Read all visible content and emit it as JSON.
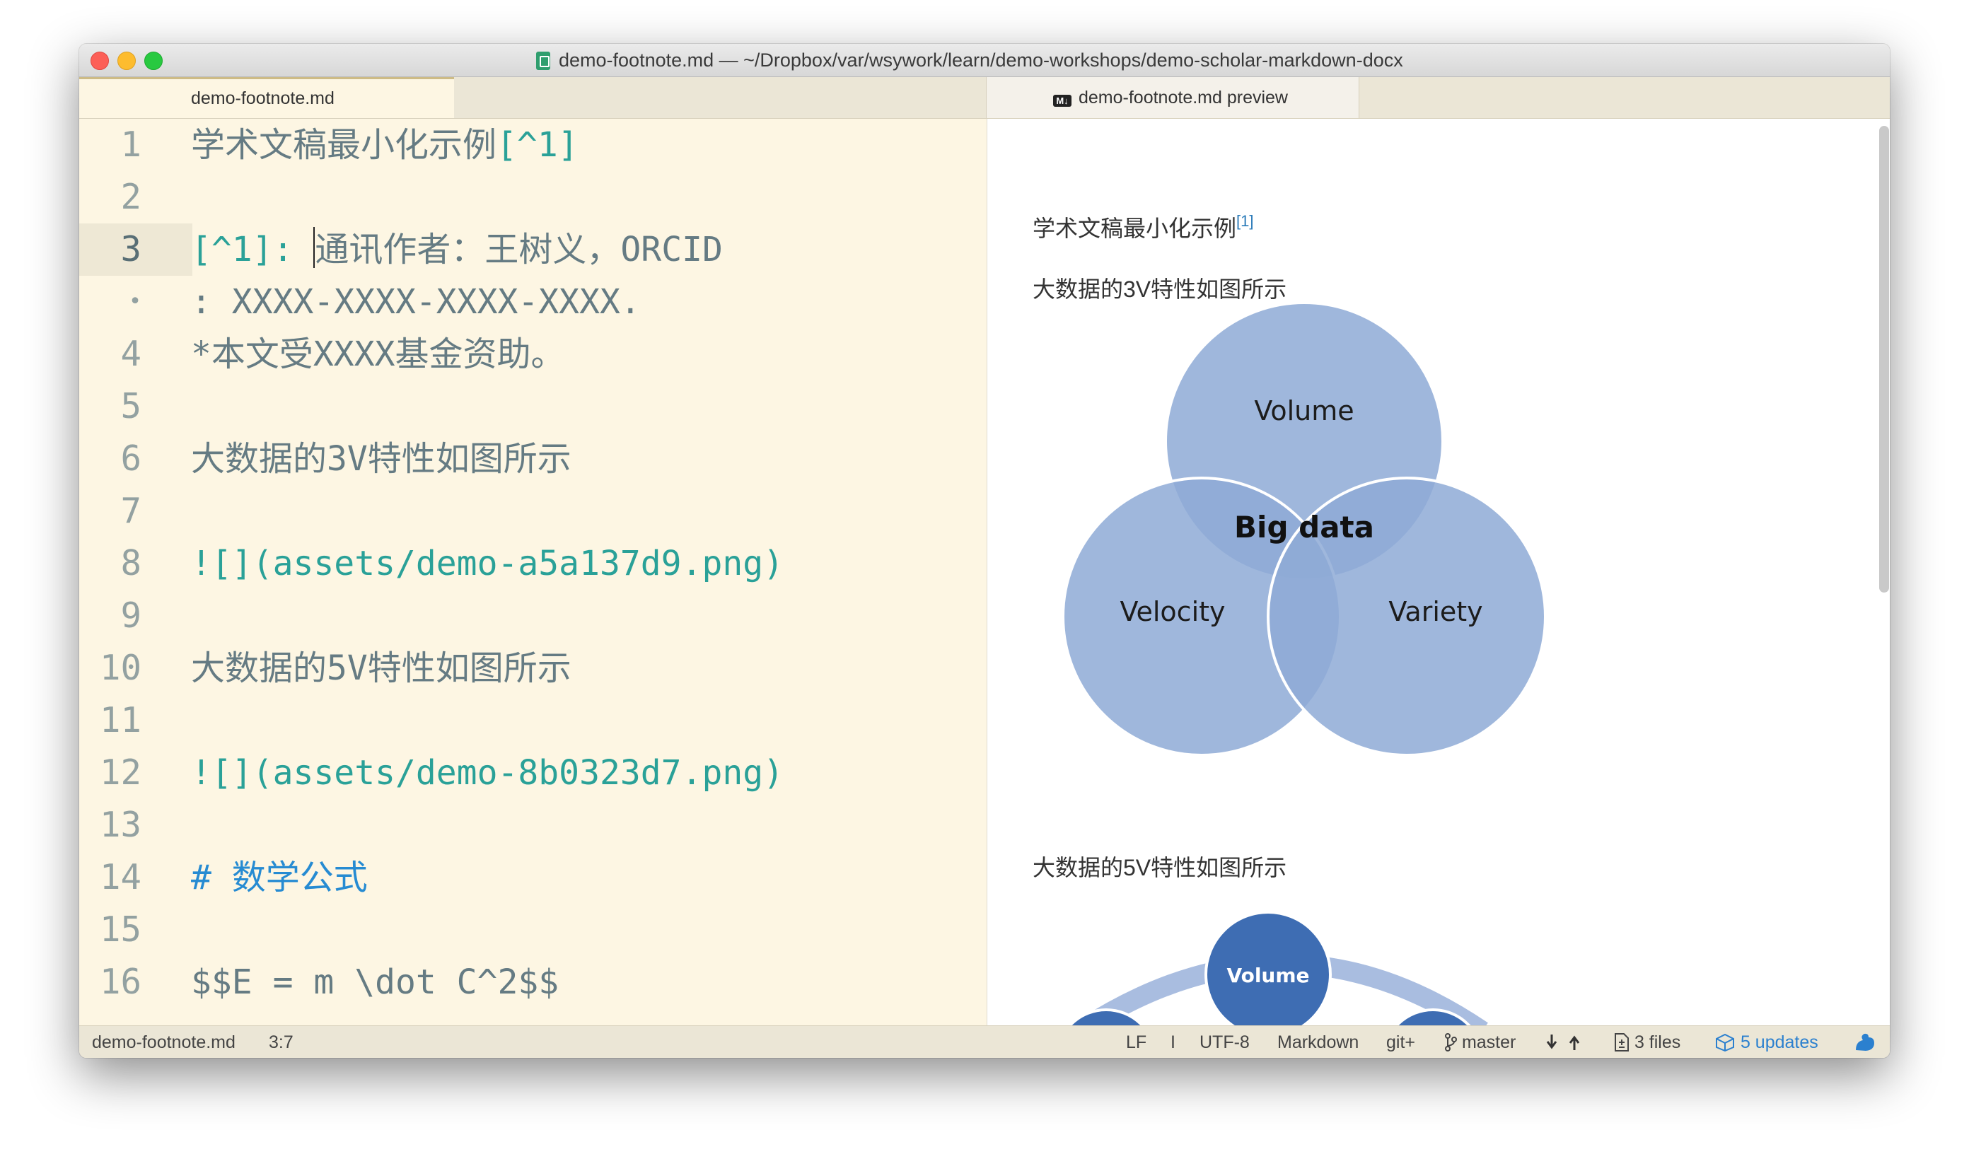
{
  "window": {
    "title": "demo-footnote.md — ~/Dropbox/var/wsywork/learn/demo-workshops/demo-scholar-markdown-docx"
  },
  "tabs": [
    {
      "label": "demo-footnote.md"
    },
    {
      "label": "demo-footnote.md preview"
    }
  ],
  "gutter": [
    "1",
    "2",
    "3",
    "•",
    "4",
    "5",
    "6",
    "7",
    "8",
    "9",
    "10",
    "11",
    "12",
    "13",
    "14",
    "15",
    "16"
  ],
  "editor": {
    "line1_text": "学术文稿最小化示例",
    "line1_ref": "[^1]",
    "line3_ref": "[^1]: ",
    "line3_text": "通讯作者：王树义，ORCID",
    "line3_wrap": ": XXXX-XXXX-XXXX-XXXX.",
    "line4": "*本文受XXXX基金资助。",
    "line6": "大数据的3V特性如图所示",
    "line8": "![](assets/demo-a5a137d9.png)",
    "line10": "大数据的5V特性如图所示",
    "line12": "![](assets/demo-8b0323d7.png)",
    "line14": "# 数学公式",
    "line16": "$$E = m \\dot C^2$$"
  },
  "preview": {
    "title": "学术文稿最小化示例",
    "title_sup": "[1]",
    "caption_3v": "大数据的3V特性如图所示",
    "venn": {
      "top": "Volume",
      "left": "Velocity",
      "right": "Variety",
      "center": "Big data"
    },
    "caption_5v": "大数据的5V特性如图所示",
    "fivev_top": "Volume"
  },
  "statusbar": {
    "filename": "demo-footnote.md",
    "cursor": "3:7",
    "line_ending": "LF",
    "separator": "I",
    "encoding": "UTF-8",
    "grammar": "Markdown",
    "git": "git+",
    "branch": "master",
    "files": "3 files",
    "updates": "5 updates"
  },
  "colors": {
    "editor_bg": "#fdf6e3",
    "text": "#657b83",
    "markup_teal": "#2aa198",
    "heading_blue": "#268bd2",
    "venn_fill": "#8eaad6",
    "link_blue": "#2b80cf"
  }
}
